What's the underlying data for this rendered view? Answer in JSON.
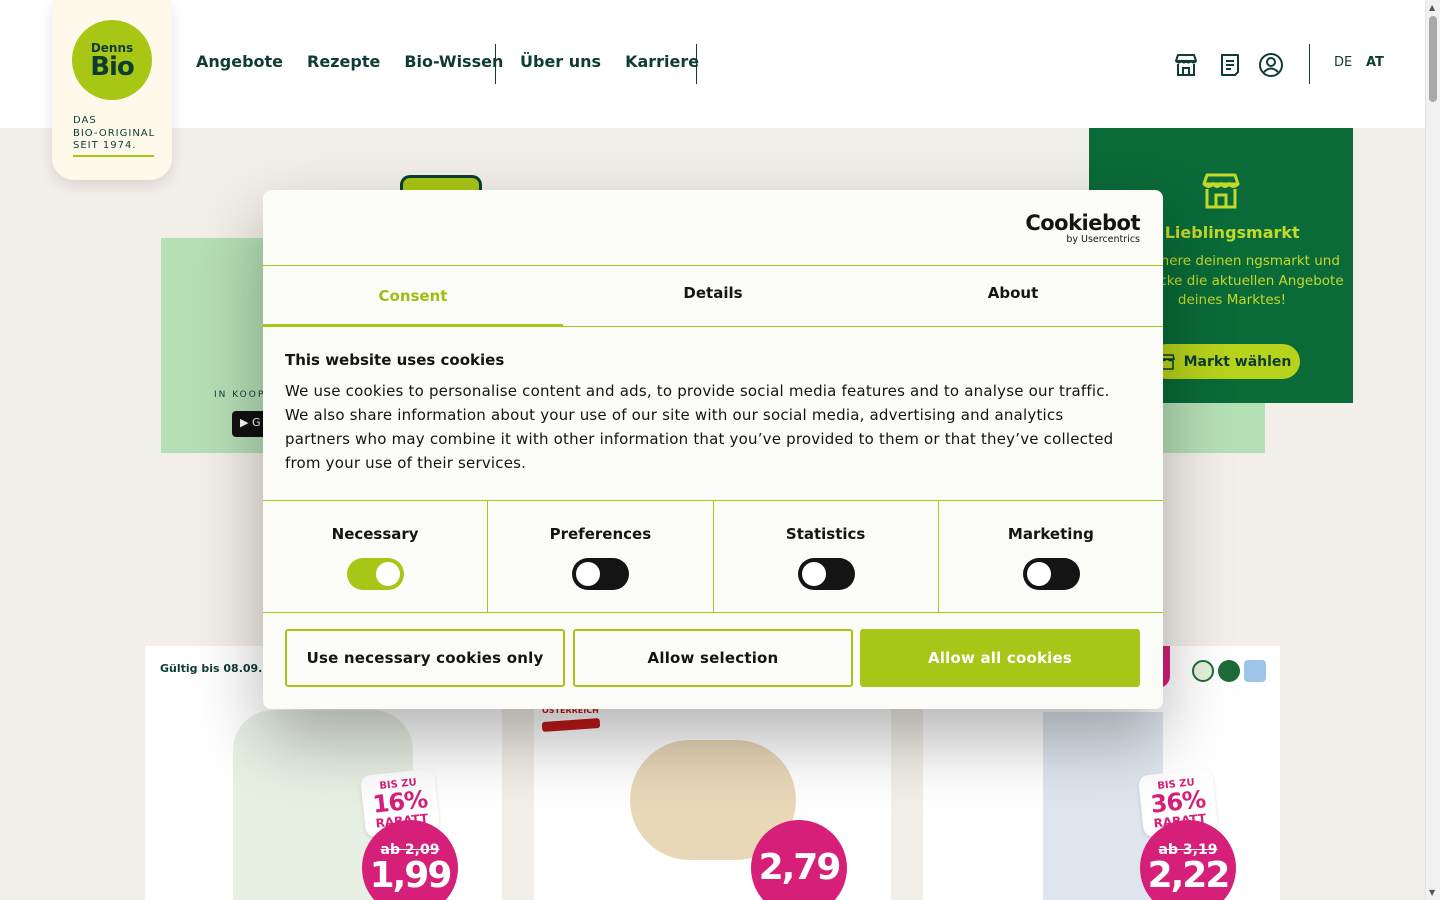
{
  "header": {
    "logo": {
      "top": "Denns",
      "main": "Bio",
      "tagline": [
        "DAS",
        "BIO-ORIGINAL",
        "SEIT 1974."
      ]
    },
    "nav_primary": [
      "Angebote",
      "Rezepte",
      "Bio-Wissen"
    ],
    "nav_secondary": [
      "Über uns",
      "Karriere"
    ],
    "icons": [
      "store-icon",
      "shopping-list-icon",
      "account-icon"
    ],
    "languages": {
      "de": "DE",
      "at": "AT",
      "active": "AT"
    }
  },
  "promo": {
    "cooperation_text": "IN KOOPE",
    "store_badge": "▶ G"
  },
  "market_card": {
    "title": "in Lieblingsmarkt",
    "text": "Speichere deinen ngsmarkt und entdecke die aktuellen Angebote deines Marktes!",
    "button": "Markt wählen"
  },
  "products": [
    {
      "validity": "Gültig bis 08.09.26",
      "discount": {
        "a": "BIS ZU",
        "b": "16%",
        "c": "RABATT"
      },
      "old_price": "ab 2,09",
      "price": "1,99"
    },
    {
      "origin": "ÖSTERREICH",
      "price": "2,79"
    },
    {
      "discount": {
        "a": "BIS ZU",
        "b": "36%",
        "c": "RABATT"
      },
      "old_price": "ab 3,19",
      "price": "2,22"
    }
  ],
  "cookie_dialog": {
    "brand": "Cookiebot",
    "brand_sub": "by Usercentrics",
    "tabs": [
      "Consent",
      "Details",
      "About"
    ],
    "active_tab": "Consent",
    "title": "This website uses cookies",
    "body": "We use cookies to personalise content and ads, to provide social media features and to analyse our traffic. We also share information about your use of our site with our social media, advertising and analytics partners who may combine it with other information that you’ve provided to them or that they’ve collected from your use of their services.",
    "categories": [
      {
        "label": "Necessary",
        "enabled": true
      },
      {
        "label": "Preferences",
        "enabled": false
      },
      {
        "label": "Statistics",
        "enabled": false
      },
      {
        "label": "Marketing",
        "enabled": false
      }
    ],
    "buttons": {
      "necessary_only": "Use necessary cookies only",
      "allow_selection": "Allow selection",
      "allow_all": "Allow all cookies"
    }
  },
  "colors": {
    "brand_green": "#a8c614",
    "dark_green": "#0e3c34",
    "market_green": "#0a6a38",
    "accent_pink": "#d61f79",
    "cookie_accent": "#a7c718"
  }
}
